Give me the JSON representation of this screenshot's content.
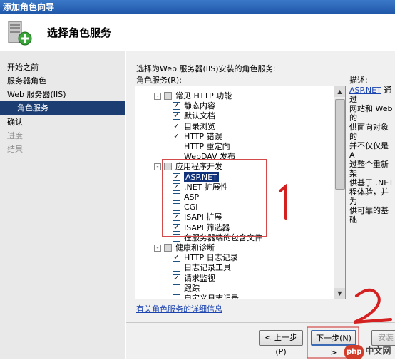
{
  "window": {
    "title": "添加角色向导"
  },
  "header": {
    "title": "选择角色服务",
    "icon": "server-add-icon"
  },
  "sidebar": {
    "items": [
      {
        "label": "开始之前",
        "state": "normal"
      },
      {
        "label": "服务器角色",
        "state": "normal"
      },
      {
        "label": "Web 服务器(IIS)",
        "state": "normal"
      },
      {
        "label": "角色服务",
        "state": "selected"
      },
      {
        "label": "确认",
        "state": "normal"
      },
      {
        "label": "进度",
        "state": "disabled"
      },
      {
        "label": "结果",
        "state": "disabled"
      }
    ]
  },
  "main": {
    "instruction": "选择为Web 服务器(IIS)安装的角色服务:",
    "services_label": "角色服务(R):",
    "description_label": "描述:",
    "more_info_link": "有关角色服务的详细信息"
  },
  "tree": [
    {
      "label": "常见 HTTP 功能",
      "level": 0,
      "checked": "partial",
      "expander": "-"
    },
    {
      "label": "静态内容",
      "level": 1,
      "checked": true
    },
    {
      "label": "默认文档",
      "level": 1,
      "checked": true
    },
    {
      "label": "目录浏览",
      "level": 1,
      "checked": true
    },
    {
      "label": "HTTP 错误",
      "level": 1,
      "checked": true
    },
    {
      "label": "HTTP 重定向",
      "level": 1,
      "checked": false
    },
    {
      "label": "WebDAV 发布",
      "level": 1,
      "checked": false
    },
    {
      "label": "应用程序开发",
      "level": 0,
      "checked": "partial",
      "expander": "-"
    },
    {
      "label": "ASP.NET",
      "level": 1,
      "checked": true,
      "highlighted": true
    },
    {
      "label": ".NET 扩展性",
      "level": 1,
      "checked": true
    },
    {
      "label": "ASP",
      "level": 1,
      "checked": false
    },
    {
      "label": "CGI",
      "level": 1,
      "checked": false
    },
    {
      "label": "ISAPI 扩展",
      "level": 1,
      "checked": true
    },
    {
      "label": "ISAPI 筛选器",
      "level": 1,
      "checked": true
    },
    {
      "label": "在服务器端的包含文件",
      "level": 1,
      "checked": false
    },
    {
      "label": "健康和诊断",
      "level": 0,
      "checked": "partial",
      "expander": "-"
    },
    {
      "label": "HTTP 日志记录",
      "level": 1,
      "checked": true
    },
    {
      "label": "日志记录工具",
      "level": 1,
      "checked": false
    },
    {
      "label": "请求监视",
      "level": 1,
      "checked": true
    },
    {
      "label": "跟踪",
      "level": 1,
      "checked": false
    },
    {
      "label": "自定义日志记录",
      "level": 1,
      "checked": false
    }
  ],
  "description": {
    "link": "ASP.NET",
    "lines": [
      "通过",
      "网站和 Web 的",
      "供面向对象的",
      "并不仅仅是 A",
      "过整个重新架",
      "供基于 .NET",
      "程体验，并为",
      "供可靠的基础"
    ]
  },
  "buttons": {
    "prev": "< 上一步(P)",
    "next": "下一步(N) >",
    "install": "安装"
  },
  "watermark": {
    "logo": "php",
    "text": "中文网"
  },
  "colors": {
    "title_bar": "#1f56a8",
    "selected_nav": "#1c3d72",
    "link": "#1a43b0",
    "annotation": "#d24a4a"
  }
}
